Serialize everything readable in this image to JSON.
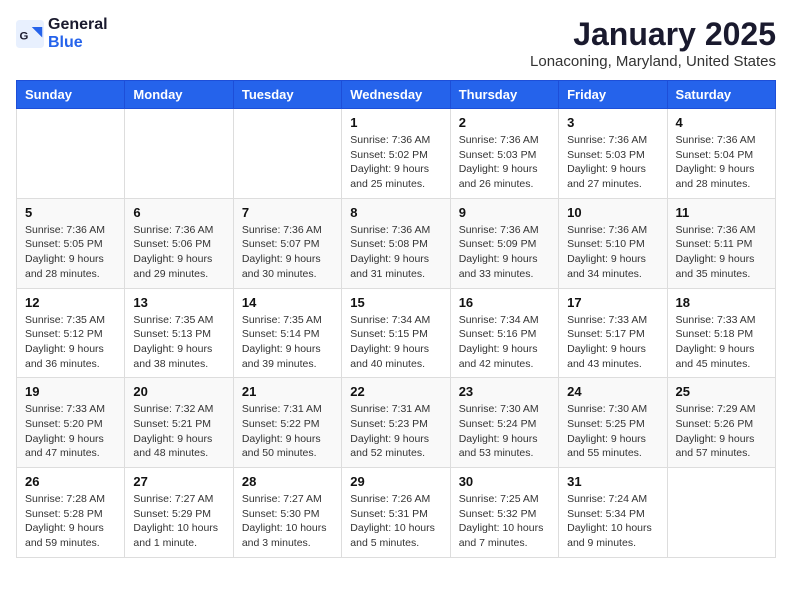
{
  "header": {
    "logo_line1": "General",
    "logo_line2": "Blue",
    "month": "January 2025",
    "location": "Lonaconing, Maryland, United States"
  },
  "weekdays": [
    "Sunday",
    "Monday",
    "Tuesday",
    "Wednesday",
    "Thursday",
    "Friday",
    "Saturday"
  ],
  "weeks": [
    [
      {
        "day": "",
        "detail": ""
      },
      {
        "day": "",
        "detail": ""
      },
      {
        "day": "",
        "detail": ""
      },
      {
        "day": "1",
        "detail": "Sunrise: 7:36 AM\nSunset: 5:02 PM\nDaylight: 9 hours\nand 25 minutes."
      },
      {
        "day": "2",
        "detail": "Sunrise: 7:36 AM\nSunset: 5:03 PM\nDaylight: 9 hours\nand 26 minutes."
      },
      {
        "day": "3",
        "detail": "Sunrise: 7:36 AM\nSunset: 5:03 PM\nDaylight: 9 hours\nand 27 minutes."
      },
      {
        "day": "4",
        "detail": "Sunrise: 7:36 AM\nSunset: 5:04 PM\nDaylight: 9 hours\nand 28 minutes."
      }
    ],
    [
      {
        "day": "5",
        "detail": "Sunrise: 7:36 AM\nSunset: 5:05 PM\nDaylight: 9 hours\nand 28 minutes."
      },
      {
        "day": "6",
        "detail": "Sunrise: 7:36 AM\nSunset: 5:06 PM\nDaylight: 9 hours\nand 29 minutes."
      },
      {
        "day": "7",
        "detail": "Sunrise: 7:36 AM\nSunset: 5:07 PM\nDaylight: 9 hours\nand 30 minutes."
      },
      {
        "day": "8",
        "detail": "Sunrise: 7:36 AM\nSunset: 5:08 PM\nDaylight: 9 hours\nand 31 minutes."
      },
      {
        "day": "9",
        "detail": "Sunrise: 7:36 AM\nSunset: 5:09 PM\nDaylight: 9 hours\nand 33 minutes."
      },
      {
        "day": "10",
        "detail": "Sunrise: 7:36 AM\nSunset: 5:10 PM\nDaylight: 9 hours\nand 34 minutes."
      },
      {
        "day": "11",
        "detail": "Sunrise: 7:36 AM\nSunset: 5:11 PM\nDaylight: 9 hours\nand 35 minutes."
      }
    ],
    [
      {
        "day": "12",
        "detail": "Sunrise: 7:35 AM\nSunset: 5:12 PM\nDaylight: 9 hours\nand 36 minutes."
      },
      {
        "day": "13",
        "detail": "Sunrise: 7:35 AM\nSunset: 5:13 PM\nDaylight: 9 hours\nand 38 minutes."
      },
      {
        "day": "14",
        "detail": "Sunrise: 7:35 AM\nSunset: 5:14 PM\nDaylight: 9 hours\nand 39 minutes."
      },
      {
        "day": "15",
        "detail": "Sunrise: 7:34 AM\nSunset: 5:15 PM\nDaylight: 9 hours\nand 40 minutes."
      },
      {
        "day": "16",
        "detail": "Sunrise: 7:34 AM\nSunset: 5:16 PM\nDaylight: 9 hours\nand 42 minutes."
      },
      {
        "day": "17",
        "detail": "Sunrise: 7:33 AM\nSunset: 5:17 PM\nDaylight: 9 hours\nand 43 minutes."
      },
      {
        "day": "18",
        "detail": "Sunrise: 7:33 AM\nSunset: 5:18 PM\nDaylight: 9 hours\nand 45 minutes."
      }
    ],
    [
      {
        "day": "19",
        "detail": "Sunrise: 7:33 AM\nSunset: 5:20 PM\nDaylight: 9 hours\nand 47 minutes."
      },
      {
        "day": "20",
        "detail": "Sunrise: 7:32 AM\nSunset: 5:21 PM\nDaylight: 9 hours\nand 48 minutes."
      },
      {
        "day": "21",
        "detail": "Sunrise: 7:31 AM\nSunset: 5:22 PM\nDaylight: 9 hours\nand 50 minutes."
      },
      {
        "day": "22",
        "detail": "Sunrise: 7:31 AM\nSunset: 5:23 PM\nDaylight: 9 hours\nand 52 minutes."
      },
      {
        "day": "23",
        "detail": "Sunrise: 7:30 AM\nSunset: 5:24 PM\nDaylight: 9 hours\nand 53 minutes."
      },
      {
        "day": "24",
        "detail": "Sunrise: 7:30 AM\nSunset: 5:25 PM\nDaylight: 9 hours\nand 55 minutes."
      },
      {
        "day": "25",
        "detail": "Sunrise: 7:29 AM\nSunset: 5:26 PM\nDaylight: 9 hours\nand 57 minutes."
      }
    ],
    [
      {
        "day": "26",
        "detail": "Sunrise: 7:28 AM\nSunset: 5:28 PM\nDaylight: 9 hours\nand 59 minutes."
      },
      {
        "day": "27",
        "detail": "Sunrise: 7:27 AM\nSunset: 5:29 PM\nDaylight: 10 hours\nand 1 minute."
      },
      {
        "day": "28",
        "detail": "Sunrise: 7:27 AM\nSunset: 5:30 PM\nDaylight: 10 hours\nand 3 minutes."
      },
      {
        "day": "29",
        "detail": "Sunrise: 7:26 AM\nSunset: 5:31 PM\nDaylight: 10 hours\nand 5 minutes."
      },
      {
        "day": "30",
        "detail": "Sunrise: 7:25 AM\nSunset: 5:32 PM\nDaylight: 10 hours\nand 7 minutes."
      },
      {
        "day": "31",
        "detail": "Sunrise: 7:24 AM\nSunset: 5:34 PM\nDaylight: 10 hours\nand 9 minutes."
      },
      {
        "day": "",
        "detail": ""
      }
    ]
  ]
}
